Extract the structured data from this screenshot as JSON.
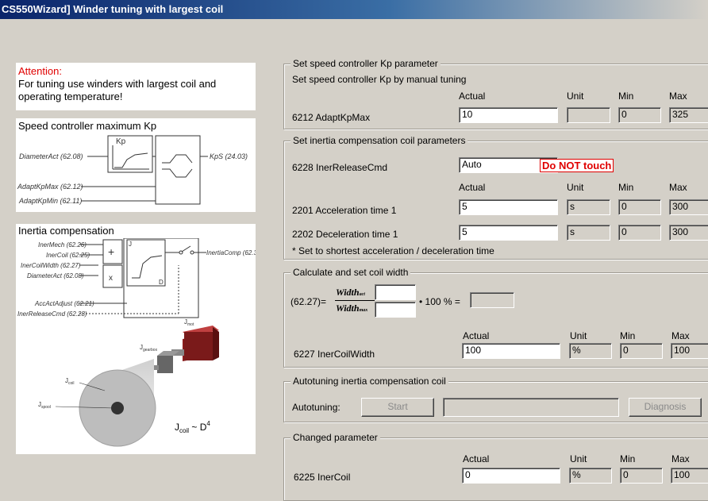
{
  "window": {
    "title": "CS550Wizard] Winder tuning with largest coil"
  },
  "left": {
    "attention_title": "Attention:",
    "attention_text_1": "For tuning use winders with largest coil and",
    "attention_text_2": "operating temperature!",
    "speed_title": "Speed controller maximum Kp",
    "speed_diagram": {
      "kp": "Kp",
      "diameter": "DiameterAct (62.08)",
      "adaptmax": "AdaptKpMax (62.12)",
      "adaptmin": "AdaptKpMin (62.11)",
      "kps": "KpS (24.03)"
    },
    "inertia_title": "Inertia compensation",
    "inertia_diagram": {
      "inermech": "InerMech (62.26)",
      "inercoil": "InerCoil (62.25)",
      "inercoilwidth": "InerCoilWidth (62.27)",
      "diameteract": "DiameterAct (62.08)",
      "accact": "AccActAdjust (62.21)",
      "inerrelease": "InerReleaseCmd (62.28)",
      "inertiacomp": "InertiaComp (62.30)",
      "j": "J",
      "d": "D",
      "jmot": "J",
      "jmot_sub": "mot",
      "jgearbox": "J",
      "jgearbox_sub": "gearbox",
      "jcoil": "J",
      "jcoil_sub": "coil",
      "jspool": "J",
      "jspool_sub": "spool",
      "formula_j": "J",
      "formula_sub": "coil",
      "formula_rest": " ~ D",
      "formula_exp": "4"
    }
  },
  "g1": {
    "title": "Set speed controller Kp parameter",
    "subtitle": "Set speed controller Kp by manual tuning",
    "h_actual": "Actual",
    "h_unit": "Unit",
    "h_min": "Min",
    "h_max": "Max",
    "row_label": "6212 AdaptKpMax",
    "actual": "10",
    "unit": "",
    "min": "0",
    "max": "325"
  },
  "g2": {
    "title": "Set inertia compensation coil parameters",
    "rel_label": "6228 InerReleaseCmd",
    "rel_value": "Auto",
    "warning": "Do NOT touch",
    "h_actual": "Actual",
    "h_unit": "Unit",
    "h_min": "Min",
    "h_max": "Max",
    "r1_label": "2201 Acceleration time 1",
    "r1_actual": "5",
    "r1_unit": "s",
    "r1_min": "0",
    "r1_max": "300",
    "r2_label": "2202 Deceleration time 1",
    "r2_actual": "5",
    "r2_unit": "s",
    "r2_min": "0",
    "r2_max": "300",
    "note": "* Set to shortest acceleration / deceleration time"
  },
  "g3": {
    "title": "Calculate and set coil width",
    "formula_prefix": "(62.27)=",
    "num": "Width",
    "num_sub": "act",
    "den": "Width",
    "den_sub": "max",
    "formula_mult": "• 100 % =",
    "h_actual": "Actual",
    "h_unit": "Unit",
    "h_min": "Min",
    "h_max": "Max",
    "row_label": "6227 InerCoilWidth",
    "actual": "100",
    "unit": "%",
    "min": "0",
    "max": "100"
  },
  "g4": {
    "title": "Autotuning inertia compensation coil",
    "label": "Autotuning:",
    "start": "Start",
    "diagnosis": "Diagnosis"
  },
  "g5": {
    "title": "Changed parameter",
    "h_actual": "Actual",
    "h_unit": "Unit",
    "h_min": "Min",
    "h_max": "Max",
    "row_label": "6225 InerCoil",
    "actual": "0",
    "unit": "%",
    "min": "0",
    "max": "100"
  }
}
